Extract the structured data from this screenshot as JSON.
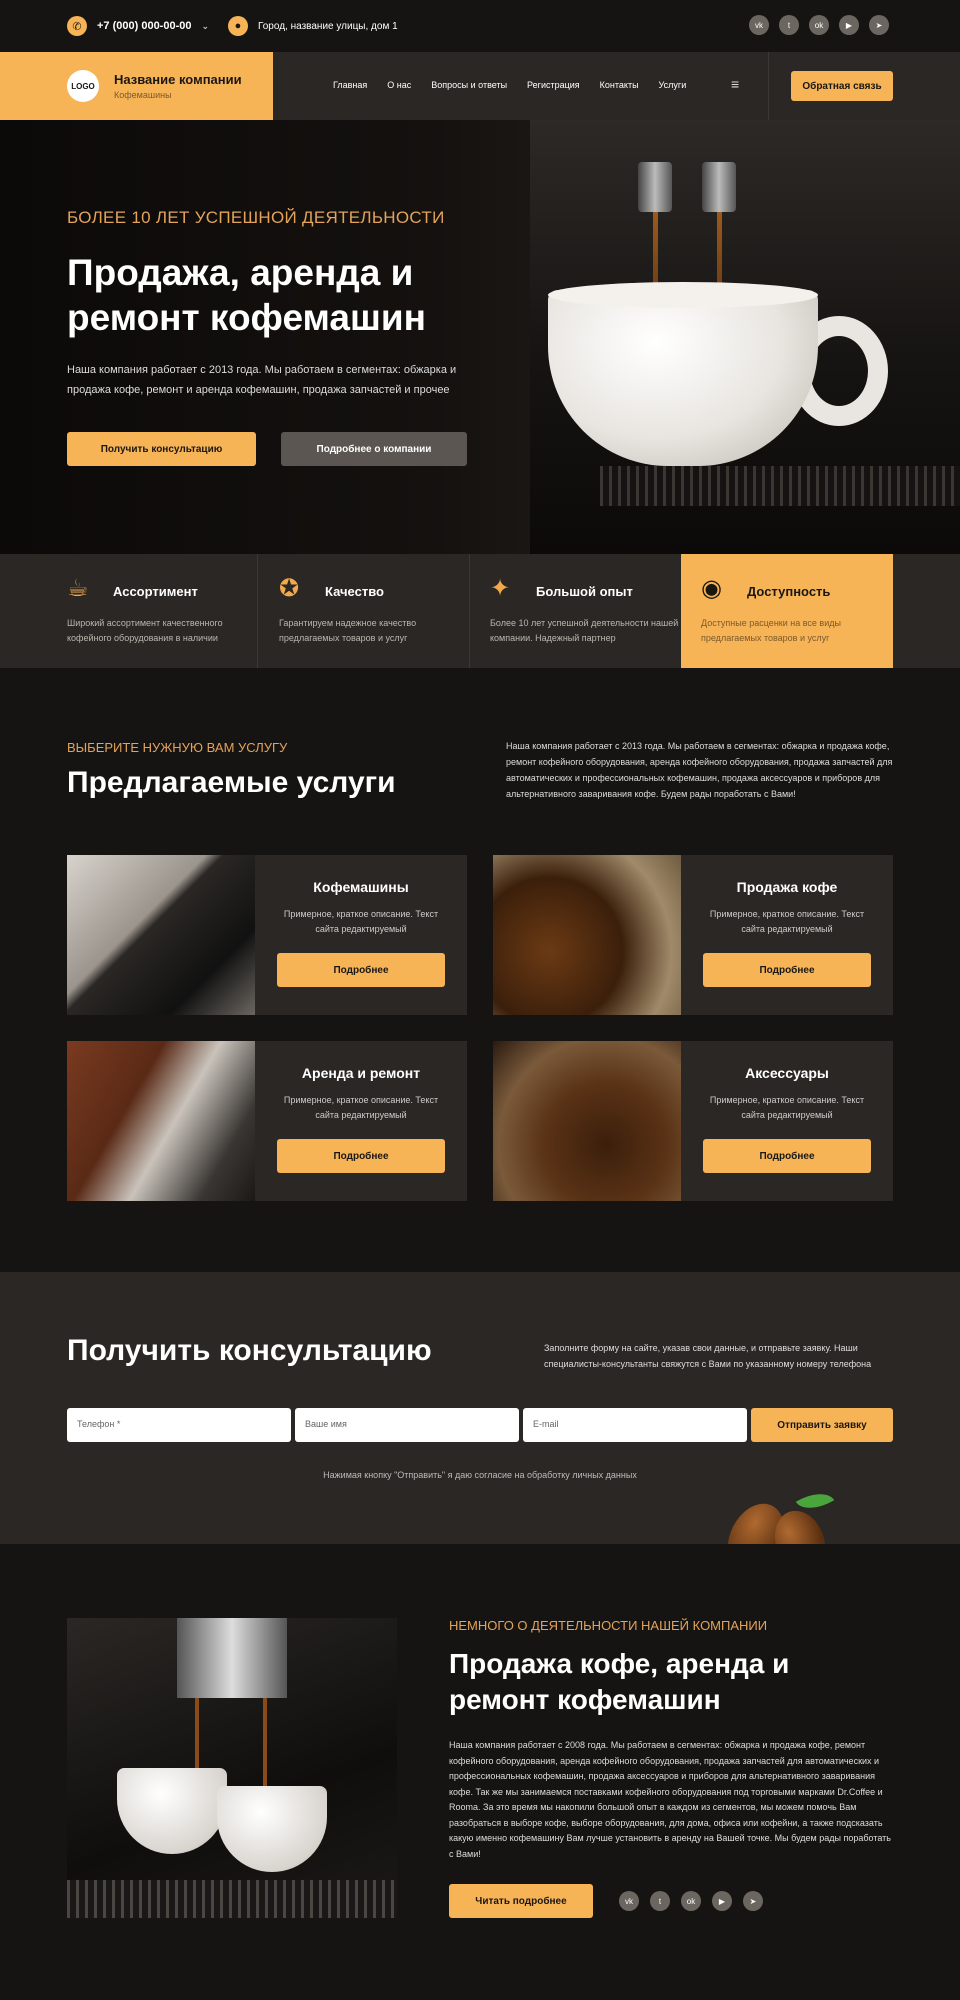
{
  "topbar": {
    "phone": "+7 (000) 000-00-00",
    "address": "Город, название улицы, дом 1",
    "social": [
      "vk",
      "tw",
      "ok",
      "yt",
      "tg"
    ]
  },
  "header": {
    "logo": "LOGO",
    "company_name": "Название компании",
    "company_sub": "Кофемашины",
    "menu": [
      "Главная",
      "О нас",
      "Вопросы и ответы",
      "Регистрация",
      "Контакты",
      "Услуги"
    ],
    "feedback": "Обратная связь"
  },
  "hero": {
    "kicker": "БОЛЕЕ 10 ЛЕТ УСПЕШНОЙ ДЕЯТЕЛЬНОСТИ",
    "title": "Продажа, аренда и ремонт кофемашин",
    "text": "Наша компания работает с 2013 года. Мы работаем в сегментах: обжарка и продажа кофе, ремонт и аренда кофемашин, продажа запчастей и прочее",
    "btn_primary": "Получить консультацию",
    "btn_secondary": "Подробнее о компании"
  },
  "features": [
    {
      "title": "Ассортимент",
      "text": "Широкий ассортимент качественного кофейного оборудования в наличии"
    },
    {
      "title": "Качество",
      "text": "Гарантируем надежное качество предлагаемых товаров и услуг"
    },
    {
      "title": "Большой опыт",
      "text": "Более 10 лет успешной деятельности нашей компании. Надежный партнер"
    },
    {
      "title": "Доступность",
      "text": "Доступные расценки на все виды предлагаемых товаров и услуг"
    }
  ],
  "services": {
    "kicker": "ВЫБЕРИТЕ НУЖНУЮ ВАМ УСЛУГУ",
    "title": "Предлагаемые услуги",
    "text": "Наша компания работает с 2013 года. Мы работаем в сегментах: обжарка и продажа кофе, ремонт кофейного оборудования, аренда кофейного оборудования, продажа запчастей для автоматических и профессиональных кофемашин, продажа аксессуаров и приборов для альтернативного заваривания кофе. Будем рады поработать с Вами!",
    "cards": [
      {
        "title": "Кофемашины",
        "text": "Примерное, краткое описание. Текст сайта редактируемый",
        "button": "Подробнее"
      },
      {
        "title": "Продажа кофе",
        "text": "Примерное, краткое описание. Текст сайта редактируемый",
        "button": "Подробнее"
      },
      {
        "title": "Аренда и ремонт",
        "text": "Примерное, краткое описание. Текст сайта редактируемый",
        "button": "Подробнее"
      },
      {
        "title": "Аксессуары",
        "text": "Примерное, краткое описание. Текст сайта редактируемый",
        "button": "Подробнее"
      }
    ]
  },
  "consult": {
    "title": "Получить консультацию",
    "text": "Заполните форму на сайте, указав свои данные, и отправьте заявку. Наши специалисты-консультанты свяжутся с Вами по указанному номеру телефона",
    "phone_placeholder": "Телефон *",
    "name_placeholder": "Ваше имя",
    "email_placeholder": "E-mail",
    "submit": "Отправить заявку",
    "consent": "Нажимая кнопку \"Отправить\" я даю согласие на обработку личных данных"
  },
  "about": {
    "kicker": "НЕМНОГО О ДЕЯТЕЛЬНОСТИ НАШЕЙ КОМПАНИИ",
    "title": "Продажа кофе, аренда и ремонт кофемашин",
    "text": "Наша компания работает с 2008 года. Мы работаем в сегментах: обжарка и продажа кофе, ремонт кофейного оборудования, аренда кофейного оборудования, продажа запчастей для автоматических и профессиональных кофемашин, продажа аксессуаров и приборов для альтернативного заваривания кофе. Так же мы занимаемся поставками кофейного оборудования под торговыми марками Dr.Coffee и Rooma. За это время мы накопили большой опыт в каждом из сегментов, мы можем помочь Вам разобраться в выборе кофе, выборе оборудования, для дома, офиса или кофейни, а также подсказать какую именно кофемашину Вам лучше установить в аренду на Вашей точке. Мы будем рады поработать с Вами!",
    "button": "Читать подробнее"
  },
  "colors": {
    "accent": "#f7b457",
    "dark": "#161412",
    "panel": "#2b2724",
    "kicker": "#e3a35a"
  }
}
